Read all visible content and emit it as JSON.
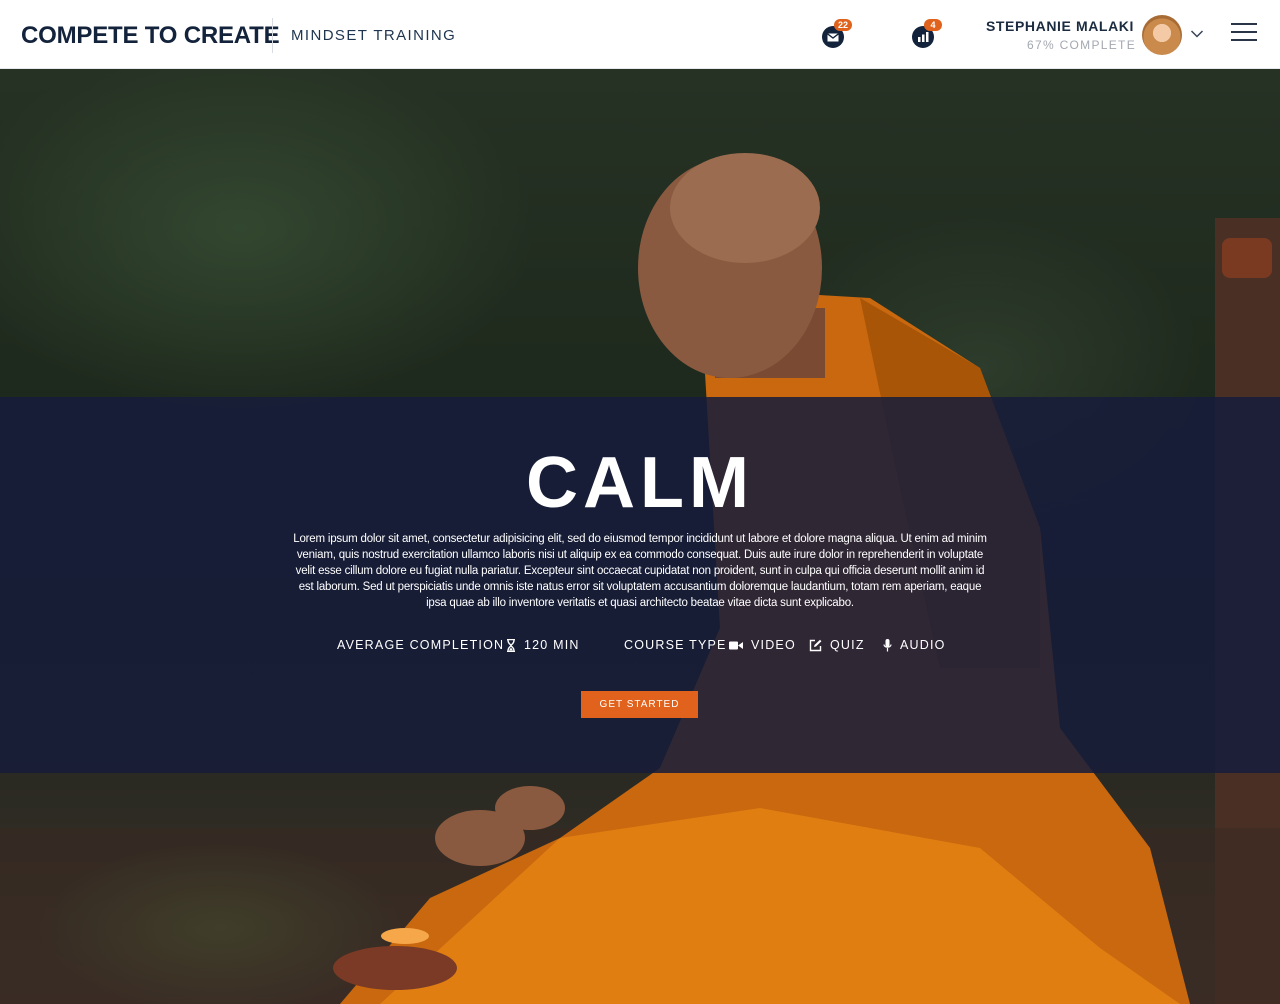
{
  "header": {
    "brand": "COMPETE TO CREATE",
    "section_title": "MINDSET TRAINING",
    "messages": {
      "icon": "mail-icon",
      "count": "22"
    },
    "stats": {
      "icon": "bar-chart-icon",
      "count": "4"
    },
    "user": {
      "name": "STEPHANIE MALAKI",
      "progress_text": "67% COMPLETE"
    }
  },
  "hero": {
    "title": "CALM",
    "description": "Lorem ipsum dolor sit amet, consectetur adipisicing elit, sed do eiusmod tempor incididunt ut labore et dolore magna aliqua. Ut enim ad minim veniam, quis nostrud exercitation ullamco laboris nisi ut aliquip ex ea commodo consequat. Duis aute irure dolor in reprehenderit in voluptate velit esse cillum dolore eu fugiat nulla pariatur. Excepteur sint occaecat cupidatat non proident, sunt in culpa qui officia deserunt mollit anim id est laborum. Sed ut perspiciatis unde omnis iste natus error sit voluptatem accusantium doloremque laudantium, totam rem aperiam, eaque ipsa quae ab illo inventore veritatis et quasi architecto beatae vitae dicta sunt explicabo.",
    "completion_label": "AVERAGE COMPLETION",
    "completion_value": "120 MIN",
    "course_type_label": "COURSE TYPE",
    "course_types": [
      "VIDEO",
      "QUIZ",
      "AUDIO"
    ],
    "cta_label": "GET STARTED"
  },
  "colors": {
    "navy": "#13233b",
    "accent": "#e0621c",
    "overlay": "#161c3a"
  }
}
